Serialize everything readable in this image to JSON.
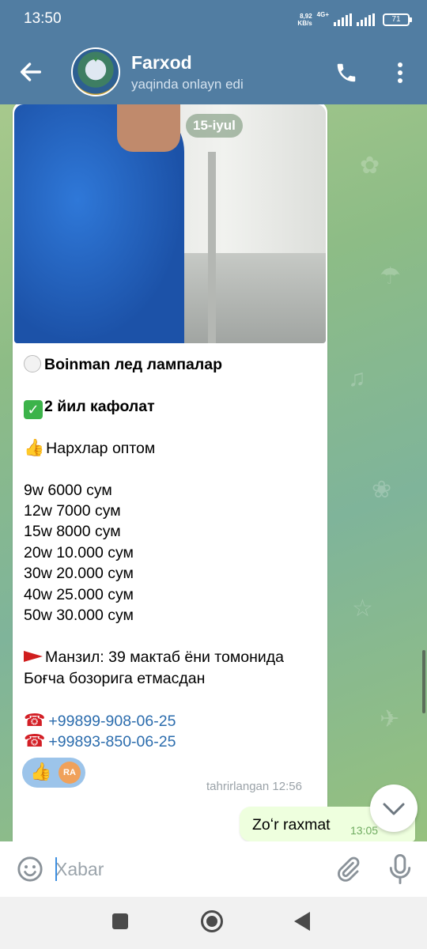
{
  "status_bar": {
    "time": "13:50",
    "speed_value": "8,92",
    "speed_unit": "KB/s",
    "network": "4G+",
    "battery": "71"
  },
  "header": {
    "contact_name": "Farxod",
    "contact_status": "yaqinda onlayn edi",
    "back_icon": "arrow-left-icon",
    "call_icon": "phone-icon",
    "menu_icon": "more-vertical-icon"
  },
  "chat": {
    "date_chip": "15-iyul",
    "incoming": {
      "lines": {
        "product": "Boinman лед лампалар",
        "warranty": "2 йил кафолат",
        "prices_header": "Нархлар оптом",
        "price_1": "9w 6000 сум",
        "price_2": "12w 7000 сум",
        "price_3": "15w 8000 сум",
        "price_4": "20w 10.000 сум",
        "price_5": "30w 20.000 сум",
        "price_6": "40w 25.000 сум",
        "price_7": "50w 30.000 сум",
        "address_1": "Манзил: 39 мактаб ёни томонида",
        "address_2": "Боғча бозорига етмасдан",
        "phone_1": "+99899-908-06-25",
        "phone_2": "+99893-850-06-25"
      },
      "reaction_avatar": "RA",
      "edited_time": "tahrirlangan 12:56"
    },
    "outgoing": {
      "text": "Zoʻr raxmat",
      "time": "13:05"
    }
  },
  "input": {
    "placeholder": "Xabar"
  },
  "colors": {
    "header_bg": "#517da2",
    "outgoing_bg": "#eeffde",
    "link": "#2b6cad",
    "wallpaper": "#8dbc86"
  }
}
